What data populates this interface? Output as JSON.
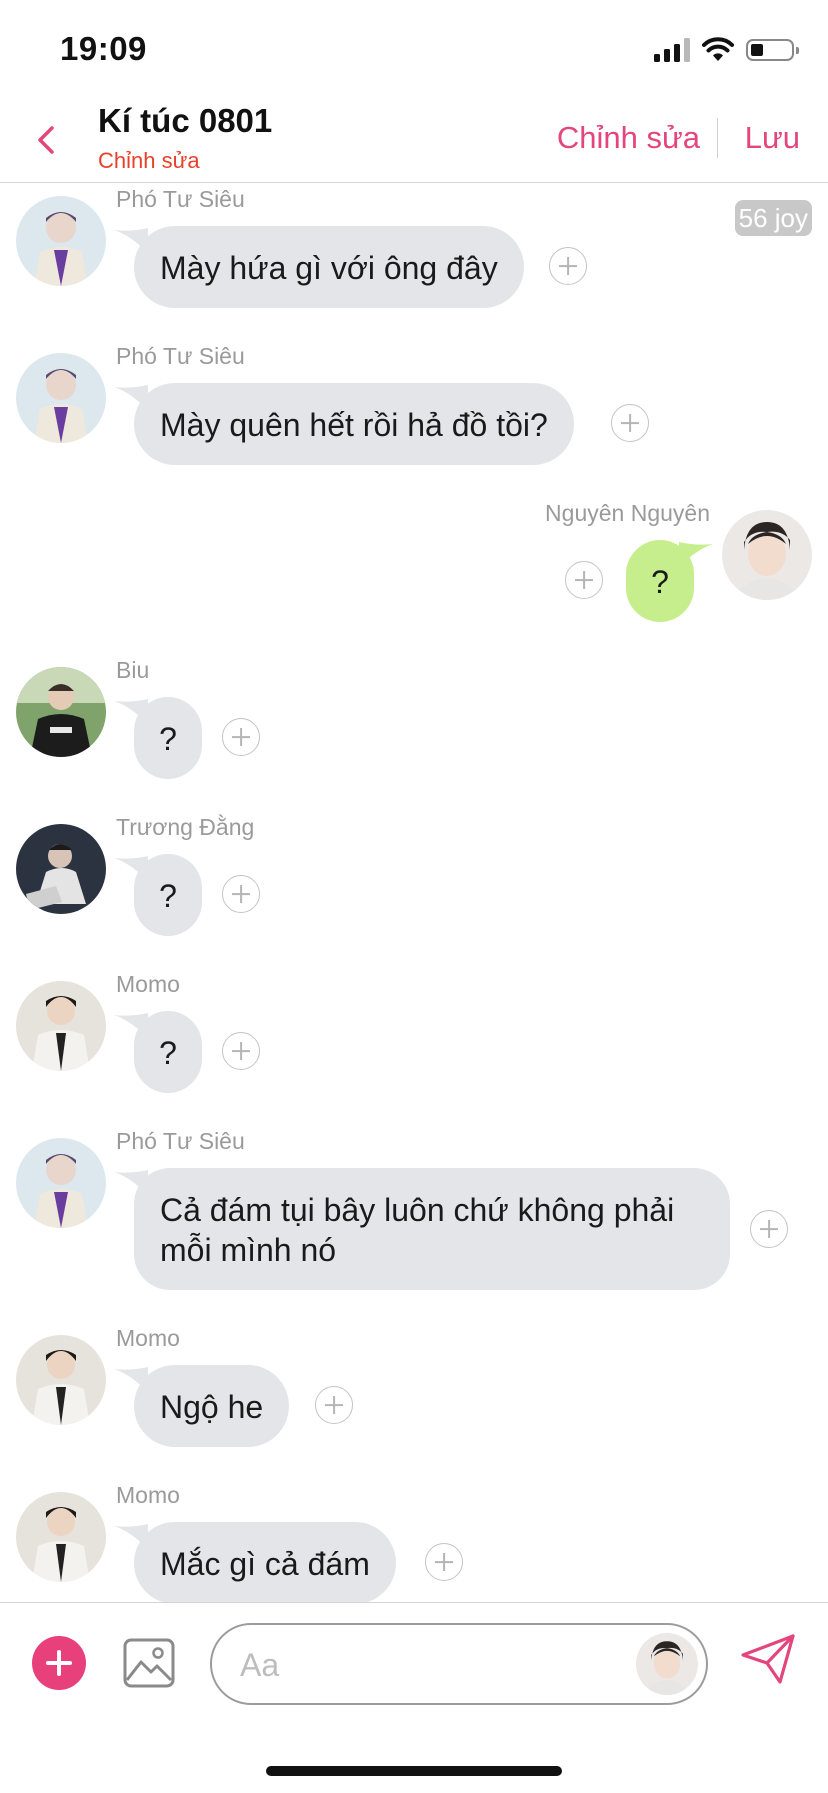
{
  "status_bar": {
    "time": "19:09"
  },
  "header": {
    "title": "Kí túc 0801",
    "subtitle": "Chỉnh sửa",
    "edit_label": "Chỉnh sửa",
    "save_label": "Lưu"
  },
  "chat": {
    "badge": "56 joy",
    "messages": [
      {
        "sender": "Phó Tư Siêu",
        "text": "Mày hứa gì với ông đây",
        "side": "left",
        "avatar": "avatar-pho-tu-sieu"
      },
      {
        "sender": "Phó Tư Siêu",
        "text": "Mày quên hết rồi hả đồ tồi?",
        "side": "left",
        "avatar": "avatar-pho-tu-sieu"
      },
      {
        "sender": "Nguyên Nguyên",
        "text": "?",
        "side": "right",
        "avatar": "avatar-nguyen-nguyen"
      },
      {
        "sender": "Biu",
        "text": "?",
        "side": "left",
        "avatar": "avatar-biu"
      },
      {
        "sender": "Trương Đằng",
        "text": "?",
        "side": "left",
        "avatar": "avatar-truong-dang"
      },
      {
        "sender": "Momo",
        "text": "?",
        "side": "left",
        "avatar": "avatar-momo"
      },
      {
        "sender": "Phó Tư Siêu",
        "text": "Cả đám tụi bây luôn chứ không phải\nmỗi mình nó",
        "side": "left",
        "avatar": "avatar-pho-tu-sieu"
      },
      {
        "sender": "Momo",
        "text": "Ngộ he",
        "side": "left",
        "avatar": "avatar-momo"
      },
      {
        "sender": "Momo",
        "text": "Mắc gì cả đám",
        "side": "left",
        "avatar": "avatar-momo"
      }
    ]
  },
  "composer": {
    "placeholder": "Aa"
  },
  "icons": {
    "back": "chevron-left-icon",
    "add": "plus-circle-icon",
    "image": "image-icon",
    "send": "paper-plane-icon",
    "reaction": "plus-icon"
  },
  "colors": {
    "accent": "#e4457a",
    "subtitle": "#e8412a",
    "bubble_left": "#e3e5e8",
    "bubble_right": "#c6ee8c",
    "add_button": "#e8407a"
  }
}
